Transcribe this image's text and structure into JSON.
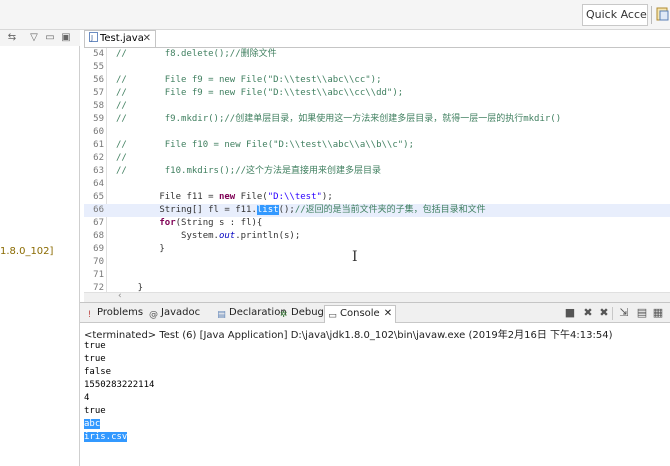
{
  "toolbar": {
    "quick_access": "Quick Access"
  },
  "left_panel": {
    "jdk_text": "1.8.0_102]"
  },
  "editor": {
    "tab_label": "Test.java",
    "tab_close": "✕",
    "lines": [
      {
        "n": "54",
        "text": "//       f8.delete();//删除文件",
        "kind": "comment"
      },
      {
        "n": "55",
        "text": "",
        "kind": "plain"
      },
      {
        "n": "56",
        "text": "//       File f9 = new File(\"D:\\\\test\\\\abc\\\\cc\");",
        "kind": "comment"
      },
      {
        "n": "57",
        "text": "//       File f9 = new File(\"D:\\\\test\\\\abc\\\\cc\\\\dd\");",
        "kind": "comment"
      },
      {
        "n": "58",
        "text": "//",
        "kind": "comment"
      },
      {
        "n": "59",
        "text": "//       f9.mkdir();//创建单层目录，如果使用这一方法来创建多层目录，就得一层一层的执行mkdir()",
        "kind": "comment"
      },
      {
        "n": "60",
        "text": "",
        "kind": "plain"
      },
      {
        "n": "61",
        "text": "//       File f10 = new File(\"D:\\\\test\\\\abc\\\\a\\\\b\\\\c\");",
        "kind": "comment"
      },
      {
        "n": "62",
        "text": "//",
        "kind": "comment"
      },
      {
        "n": "63",
        "text": "//       f10.mkdirs();//这个方法是直接用来创建多层目录",
        "kind": "comment"
      },
      {
        "n": "64",
        "text": "",
        "kind": "plain"
      },
      {
        "n": "65",
        "text": "        File f11 = new File(\"D:\\\\test\");",
        "kind": "code"
      },
      {
        "n": "66",
        "text": "        String[] fl = f11.list();//返回的是当前文件夹的子集，包括目录和文件",
        "kind": "current"
      },
      {
        "n": "67",
        "text": "        for(String s : fl){",
        "kind": "code"
      },
      {
        "n": "68",
        "text": "            System.out.println(s);",
        "kind": "code"
      },
      {
        "n": "69",
        "text": "        }",
        "kind": "code"
      },
      {
        "n": "70",
        "text": "",
        "kind": "plain"
      },
      {
        "n": "71",
        "text": "",
        "kind": "plain"
      },
      {
        "n": "72",
        "text": "    }",
        "kind": "code"
      }
    ]
  },
  "views": {
    "tabs": [
      {
        "label": "Problems",
        "icon": "problems-icon"
      },
      {
        "label": "Javadoc",
        "icon": "javadoc-icon"
      },
      {
        "label": "Declaration",
        "icon": "declaration-icon"
      },
      {
        "label": "Debug",
        "icon": "debug-icon"
      },
      {
        "label": "Console",
        "icon": "console-icon",
        "active": true
      }
    ],
    "console_close": "✕"
  },
  "console": {
    "header": "<terminated> Test (6) [Java Application] D:\\java\\jdk1.8.0_102\\bin\\javaw.exe (2019年2月16日 下午4:13:54)",
    "output": [
      "true",
      "true",
      "false",
      "1550283222114",
      "4",
      "true",
      "abc",
      "iris.csv"
    ],
    "selected_from": 6
  },
  "colors": {
    "selection": "#3399ff",
    "comment": "#3f7f5f",
    "keyword": "#7f0055",
    "string": "#2a00ff",
    "current_line": "#e8eefc"
  }
}
